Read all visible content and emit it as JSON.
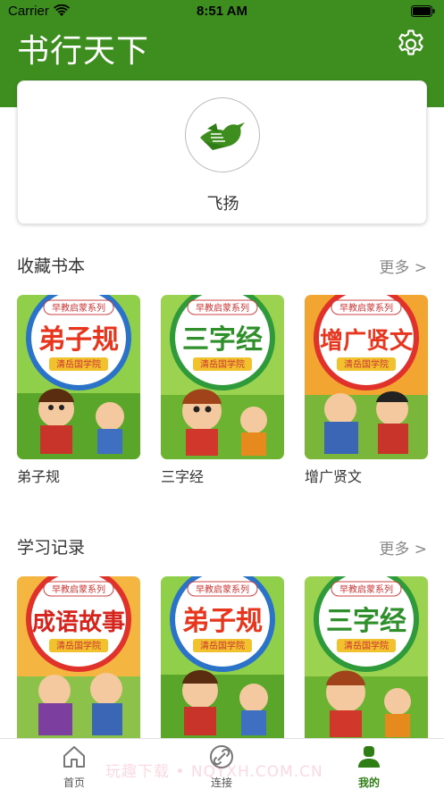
{
  "status": {
    "carrier": "Carrier",
    "time": "8:51 AM"
  },
  "header": {
    "title": "书行天下"
  },
  "profile": {
    "name": "飞扬"
  },
  "favorites": {
    "title": "收藏书本",
    "more": "更多 >",
    "books": [
      {
        "label": "弟子规",
        "cover_title": "弟子规",
        "series": "早教启蒙系列",
        "publisher": "清岳国学院"
      },
      {
        "label": "三字经",
        "cover_title": "三字经",
        "series": "早教启蒙系列",
        "publisher": "清岳国学院"
      },
      {
        "label": "增广贤文",
        "cover_title": "增广贤文",
        "series": "早教启蒙系列",
        "publisher": "清岳国学院"
      }
    ]
  },
  "history": {
    "title": "学习记录",
    "more": "更多 >",
    "books": [
      {
        "cover_title": "成语故事",
        "series": "早教启蒙系列",
        "publisher": "清岳国学院"
      },
      {
        "cover_title": "弟子规",
        "series": "早教启蒙系列",
        "publisher": "清岳国学院"
      },
      {
        "cover_title": "三字经",
        "series": "早教启蒙系列",
        "publisher": "清岳国学院"
      }
    ]
  },
  "tabs": [
    {
      "label": "首页",
      "icon": "home-icon"
    },
    {
      "label": "连接",
      "icon": "link-icon"
    },
    {
      "label": "我的",
      "icon": "person-icon"
    }
  ],
  "watermark": "玩趣下载 • NQYXH.COM.CN",
  "colors": {
    "brand_green": "#3e8e1f",
    "active_tab": "#2f7d15"
  }
}
